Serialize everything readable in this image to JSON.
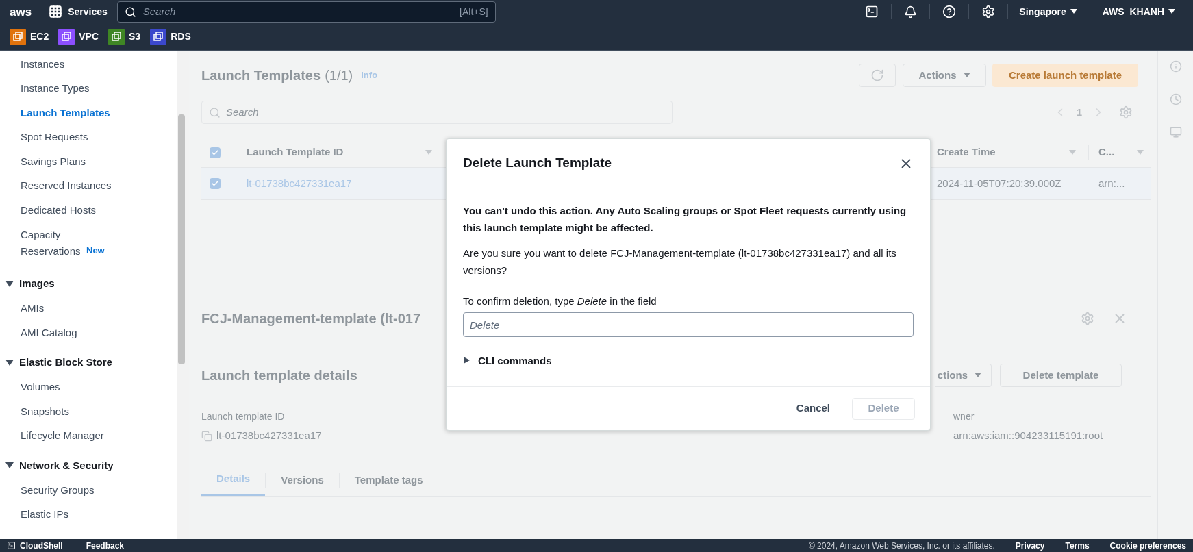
{
  "top_nav": {
    "logo": "aws",
    "services": "Services",
    "search": {
      "placeholder": "Search",
      "shortcut": "[Alt+S]"
    },
    "region": "Singapore",
    "account": "AWS_KHANH"
  },
  "favorites": [
    {
      "label": "EC2",
      "color": "#e0720c"
    },
    {
      "label": "VPC",
      "color": "#8c4fff"
    },
    {
      "label": "S3",
      "color": "#3f8624"
    },
    {
      "label": "RDS",
      "color": "#3b48cc"
    }
  ],
  "sidebar": {
    "items": [
      {
        "label": "Instances",
        "selected": false
      },
      {
        "label": "Instance Types",
        "selected": false
      },
      {
        "label": "Launch Templates",
        "selected": true
      },
      {
        "label": "Spot Requests",
        "selected": false
      },
      {
        "label": "Savings Plans",
        "selected": false
      },
      {
        "label": "Reserved Instances",
        "selected": false
      },
      {
        "label": "Dedicated Hosts",
        "selected": false
      },
      {
        "label": "Capacity Reservations",
        "selected": false,
        "badge": "New"
      }
    ],
    "sections": [
      {
        "title": "Images",
        "expanded": true,
        "items": [
          {
            "label": "AMIs",
            "selected": false
          },
          {
            "label": "AMI Catalog",
            "selected": false
          }
        ]
      },
      {
        "title": "Elastic Block Store",
        "expanded": true,
        "items": [
          {
            "label": "Volumes",
            "selected": false
          },
          {
            "label": "Snapshots",
            "selected": false
          },
          {
            "label": "Lifecycle Manager",
            "selected": false
          }
        ]
      },
      {
        "title": "Network & Security",
        "expanded": true,
        "items": [
          {
            "label": "Security Groups",
            "selected": false
          },
          {
            "label": "Elastic IPs",
            "selected": false
          }
        ]
      }
    ]
  },
  "list_panel": {
    "title": "Launch Templates",
    "count": "(1/1)",
    "info": "Info",
    "actions": "Actions",
    "create": "Create launch template",
    "search_placeholder": "Search",
    "page": "1",
    "columns": [
      "Launch Template ID",
      "Create Time",
      "C..."
    ],
    "all_checked": true,
    "rows": [
      {
        "checked": true,
        "cells": [
          "lt-01738bc427331ea17",
          "2024-11-05T07:20:39.000Z",
          "arn:..."
        ]
      }
    ]
  },
  "details_panel": {
    "title": "FCJ-Management-template (lt-017",
    "subtitle": "Launch template details",
    "actions": "ctions",
    "delete": "Delete template",
    "fields": [
      {
        "label": "Launch template ID",
        "value": "lt-01738bc427331ea17"
      },
      {
        "label": "wner",
        "value": "arn:aws:iam::904233115191:root"
      }
    ],
    "tabs": [
      {
        "label": "Details",
        "selected": true
      },
      {
        "label": "Versions",
        "selected": false
      },
      {
        "label": "Template tags",
        "selected": false
      }
    ]
  },
  "dialog": {
    "title": "Delete Launch Template",
    "warning": "You can't undo this action. Any Auto Scaling groups or Spot Fleet requests currently using this launch template might be affected.",
    "question": "Are you sure you want to delete FCJ-Management-template (lt-01738bc427331ea17) and all its versions?",
    "confirm_label": "To confirm deletion, type *Delete* in the field",
    "input_placeholder": "Delete",
    "cli": {
      "label": "CLI commands",
      "expanded": false
    },
    "cancel": "Cancel",
    "delete": {
      "label": "Delete",
      "disabled": true
    }
  },
  "footer": {
    "left": [
      "CloudShell",
      "Feedback"
    ],
    "copyright": "© 2024, Amazon Web Services, Inc. or its affiliates.",
    "links": [
      "Privacy",
      "Terms",
      "Cookie preferences"
    ]
  }
}
